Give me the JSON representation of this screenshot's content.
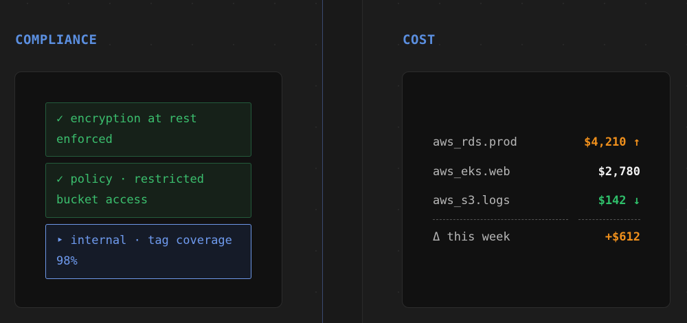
{
  "compliance": {
    "title": "COMPLIANCE",
    "cards": [
      {
        "glyph": "✓",
        "line1": "encryption at rest",
        "line2": "enforced",
        "status": "pass"
      },
      {
        "glyph": "✓",
        "line1": "policy · restricted",
        "line2": "bucket access",
        "status": "pass"
      },
      {
        "glyph": "‣",
        "line1": "internal · tag coverage",
        "line2": "98%",
        "status": "info"
      }
    ]
  },
  "cost": {
    "title": "COST",
    "rows": [
      {
        "name": "aws_rds.prod",
        "value": "$4,210 ↑",
        "trend": "up"
      },
      {
        "name": "aws_eks.web",
        "value": "$2,780",
        "trend": "flat"
      },
      {
        "name": "aws_s3.logs",
        "value": "$142 ↓",
        "trend": "down"
      }
    ],
    "total": {
      "label": "Δ this week",
      "value": "+$612"
    }
  },
  "colors": {
    "accent": "#5b8fe0",
    "pass": "#3bbf6e",
    "info": "#6f9bef",
    "cost_up": "#f0901c",
    "cost_down": "#2fbf6a"
  }
}
